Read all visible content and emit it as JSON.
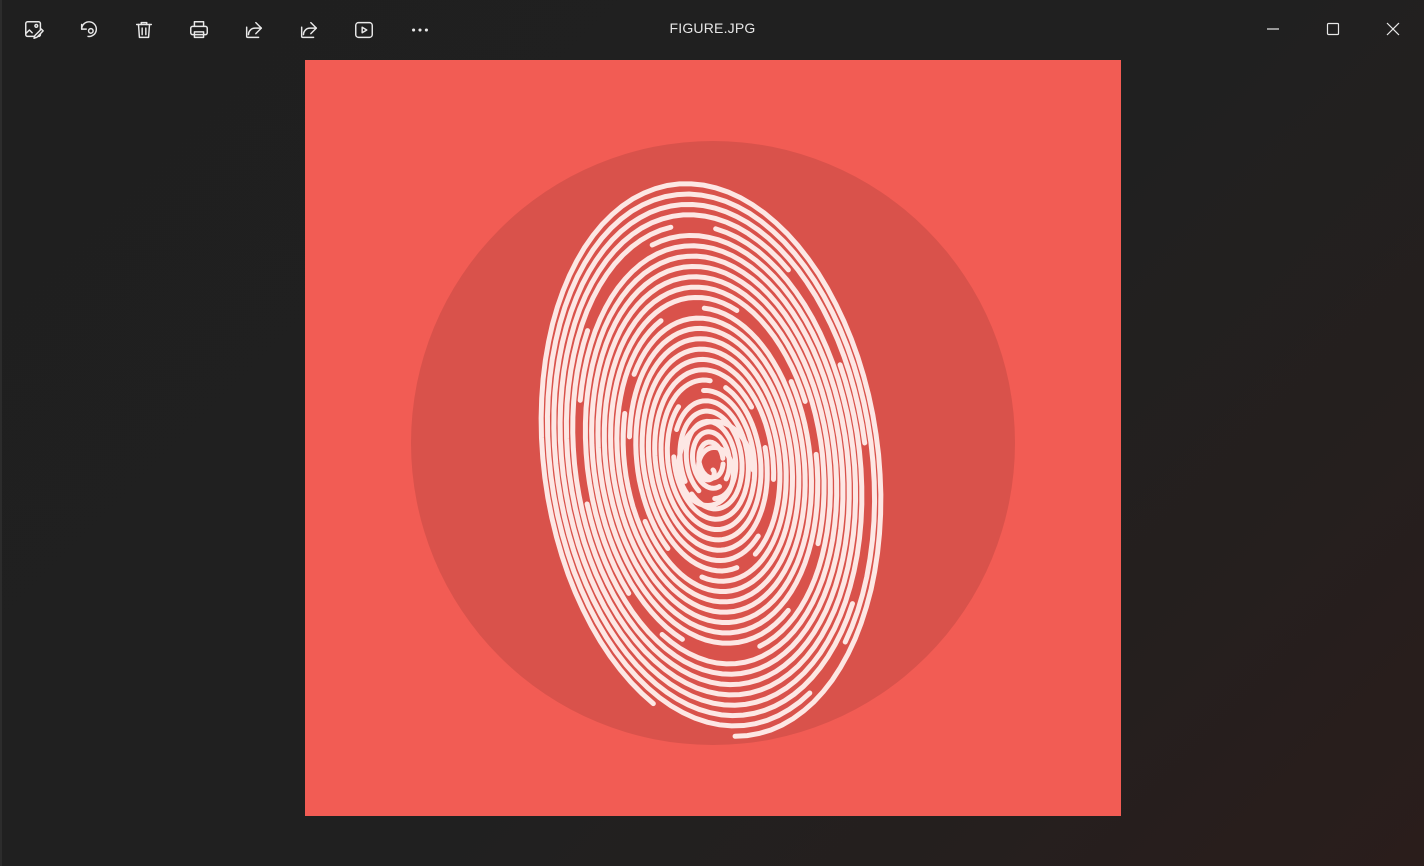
{
  "window": {
    "title": "FIGURE.JPG"
  },
  "toolbar": {
    "items": [
      {
        "name": "edit-image-icon"
      },
      {
        "name": "rotate-icon"
      },
      {
        "name": "delete-icon"
      },
      {
        "name": "print-icon"
      },
      {
        "name": "share-icon"
      },
      {
        "name": "share-alt-icon"
      },
      {
        "name": "slideshow-icon"
      },
      {
        "name": "more-options-icon"
      }
    ]
  },
  "window_controls": [
    "minimize-icon",
    "maximize-icon",
    "close-icon"
  ],
  "image": {
    "background_color": "#f25c54",
    "circle_color": "#d9524b",
    "ridge_color": "#fde7e4",
    "description_icon": "fingerprint-icon"
  }
}
